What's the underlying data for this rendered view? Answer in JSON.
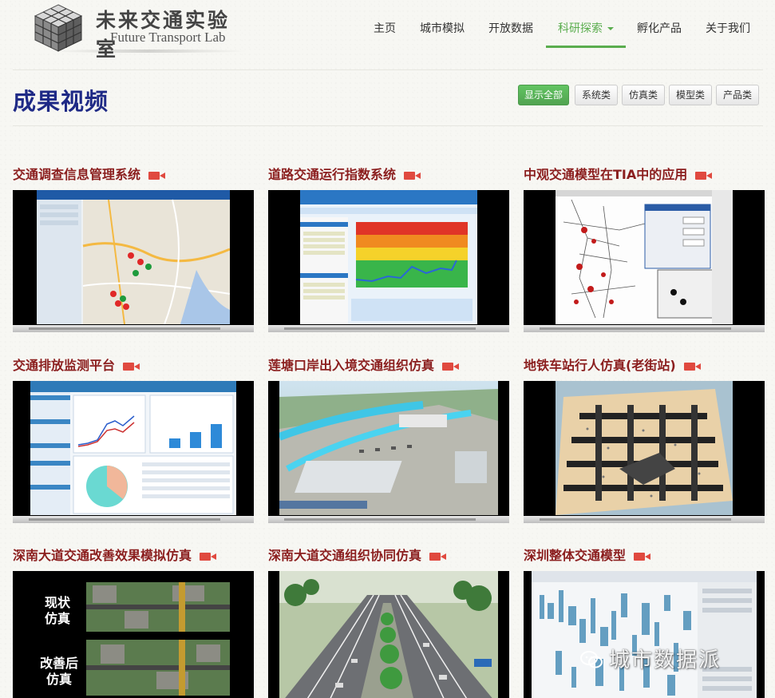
{
  "brand": {
    "name_cn": "未来交通实验室",
    "name_en": "Future Transport Lab"
  },
  "nav": {
    "items": [
      {
        "label": "主页"
      },
      {
        "label": "城市模拟"
      },
      {
        "label": "开放数据"
      },
      {
        "label": "科研探索",
        "active": true
      },
      {
        "label": "孵化产品"
      },
      {
        "label": "关于我们"
      }
    ]
  },
  "page": {
    "title": "成果视频"
  },
  "filters": [
    {
      "label": "显示全部",
      "active": true
    },
    {
      "label": "系统类"
    },
    {
      "label": "仿真类"
    },
    {
      "label": "模型类"
    },
    {
      "label": "产品类"
    }
  ],
  "videos": [
    {
      "title": "交通调查信息管理系统",
      "thumb": "map-system"
    },
    {
      "title": "道路交通运行指数系统",
      "thumb": "index-chart"
    },
    {
      "title": "中观交通模型在TIA中的应用",
      "thumb": "network-model"
    },
    {
      "title": "交通排放监测平台",
      "thumb": "emission-dashboard"
    },
    {
      "title": "莲塘口岸出入境交通组织仿真",
      "thumb": "port-3d"
    },
    {
      "title": "地铁车站行人仿真(老街站)",
      "thumb": "station-3d"
    },
    {
      "title": "深南大道交通改善效果模拟仿真",
      "thumb": "aerial-compare",
      "labels": [
        "现状\n仿真",
        "改善后\n仿真"
      ]
    },
    {
      "title": "深南大道交通组织协同仿真",
      "thumb": "road-3d"
    },
    {
      "title": "深圳整体交通模型",
      "thumb": "city-model"
    }
  ],
  "watermark": {
    "text": "城市数据派"
  },
  "colors": {
    "accent_green": "#5aad4e",
    "title_navy": "#1f2a86",
    "video_title": "#8b1e1e",
    "camera_icon": "#e0493f"
  }
}
